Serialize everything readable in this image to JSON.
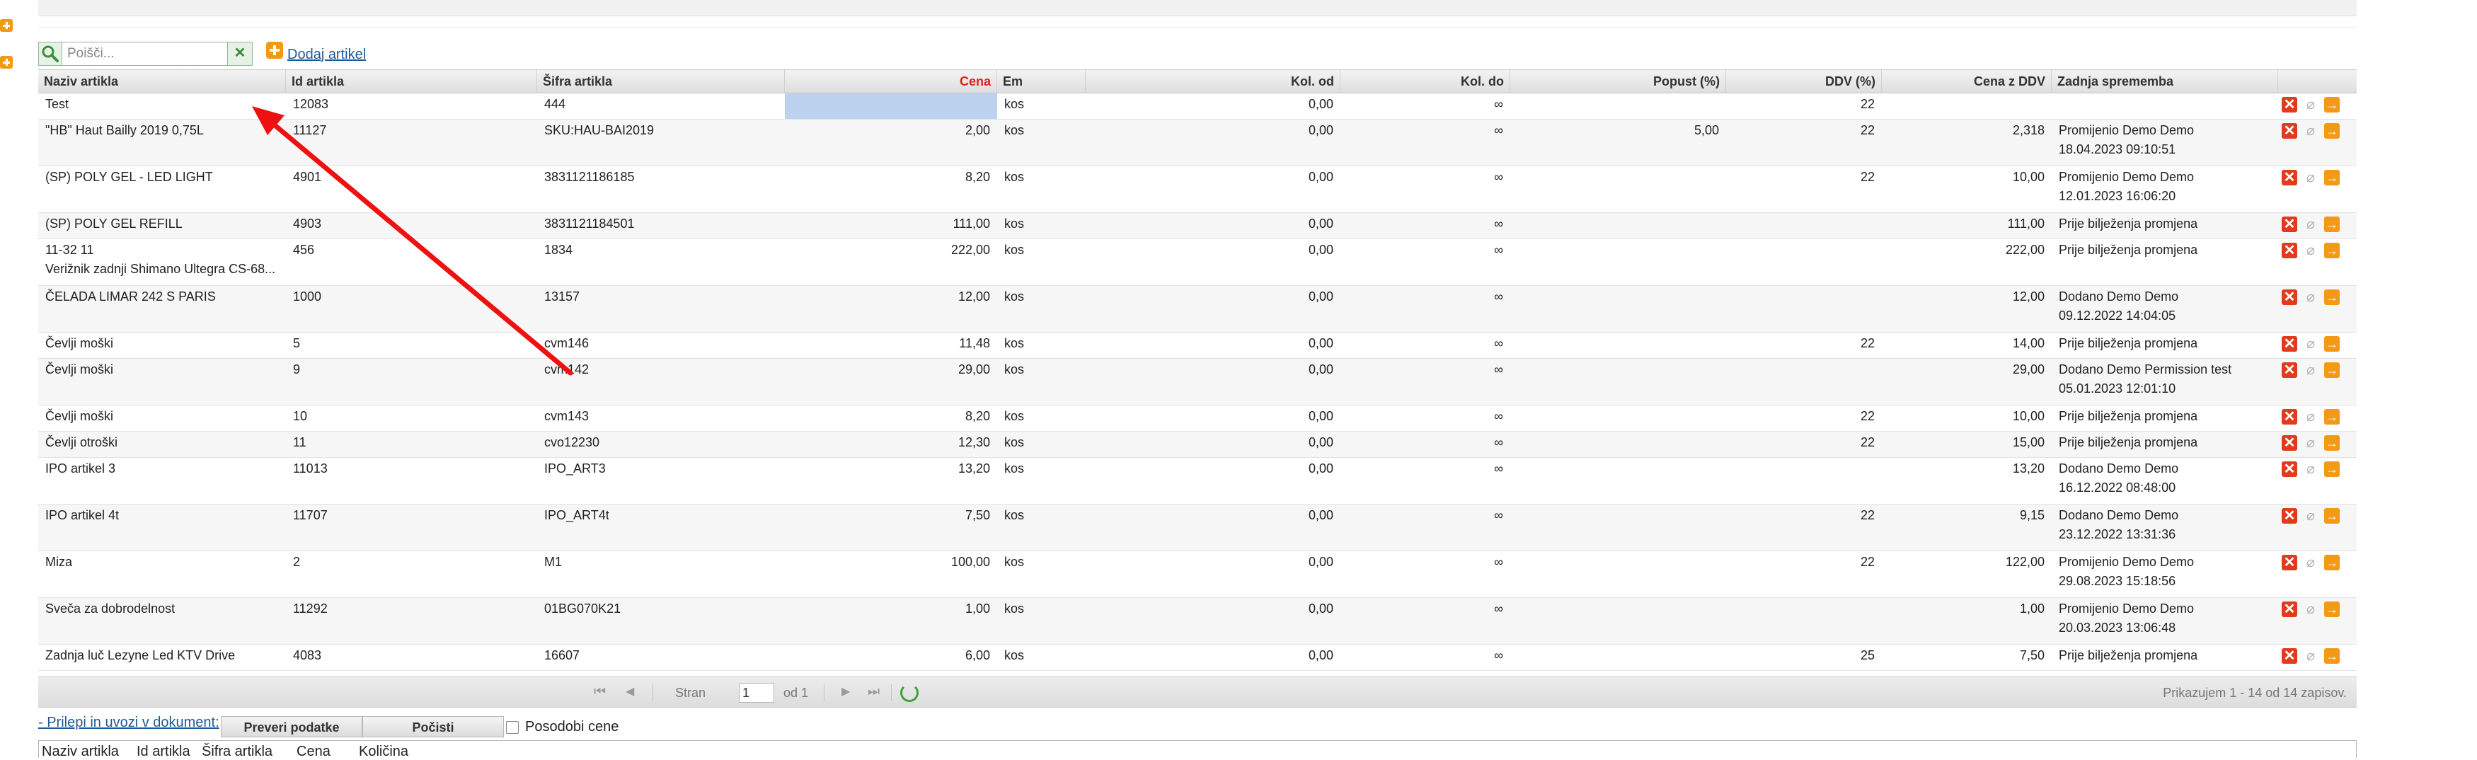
{
  "toolbar": {
    "search_placeholder": "Poišči...",
    "clear_glyph": "✕",
    "add_label": "Dodaj artikel"
  },
  "grid": {
    "columns": [
      {
        "key": "name",
        "label": "Naziv artikla"
      },
      {
        "key": "id",
        "label": "Id artikla"
      },
      {
        "key": "code",
        "label": "Šifra artikla"
      },
      {
        "key": "price",
        "label": "Cena"
      },
      {
        "key": "unit",
        "label": "Em"
      },
      {
        "key": "qty_from",
        "label": "Kol. od"
      },
      {
        "key": "qty_to",
        "label": "Kol. do"
      },
      {
        "key": "discount",
        "label": "Popust (%)"
      },
      {
        "key": "vat",
        "label": "DDV (%)"
      },
      {
        "key": "price_vat",
        "label": "Cena z DDV"
      },
      {
        "key": "last_change",
        "label": "Zadnja sprememba"
      }
    ],
    "rows": [
      {
        "name": "Test",
        "id": "12083",
        "code": "444",
        "price": "",
        "unit": "kos",
        "qty_from": "0,00",
        "qty_to": "∞",
        "discount": "",
        "vat": "22",
        "price_vat": "",
        "last_change": ""
      },
      {
        "name": "\"HB\" Haut Bailly 2019 0,75L",
        "id": "11127",
        "code": "SKU:HAU-BAI2019",
        "price": "2,00",
        "unit": "kos",
        "qty_from": "0,00",
        "qty_to": "∞",
        "discount": "5,00",
        "vat": "22",
        "price_vat": "2,318",
        "last_change": "Promijenio Demo Demo\n18.04.2023 09:10:51"
      },
      {
        "name": "(SP) POLY GEL - LED LIGHT",
        "id": "4901",
        "code": "3831121186185",
        "price": "8,20",
        "unit": "kos",
        "qty_from": "0,00",
        "qty_to": "∞",
        "discount": "",
        "vat": "22",
        "price_vat": "10,00",
        "last_change": "Promijenio Demo Demo\n12.01.2023 16:06:20"
      },
      {
        "name": "(SP) POLY GEL REFILL",
        "id": "4903",
        "code": "3831121184501",
        "price": "111,00",
        "unit": "kos",
        "qty_from": "0,00",
        "qty_to": "∞",
        "discount": "",
        "vat": "",
        "price_vat": "111,00",
        "last_change": "Prije bilježenja promjena"
      },
      {
        "name": "11-32 11\nVerižnik zadnji Shimano Ultegra CS-68...",
        "id": "456",
        "code": "1834",
        "price": "222,00",
        "unit": "kos",
        "qty_from": "0,00",
        "qty_to": "∞",
        "discount": "",
        "vat": "",
        "price_vat": "222,00",
        "last_change": "Prije bilježenja promjena"
      },
      {
        "name": "ČELADA LIMAR 242 S PARIS",
        "id": "1000",
        "code": "13157",
        "price": "12,00",
        "unit": "kos",
        "qty_from": "0,00",
        "qty_to": "∞",
        "discount": "",
        "vat": "",
        "price_vat": "12,00",
        "last_change": "Dodano Demo Demo\n09.12.2022 14:04:05"
      },
      {
        "name": "Čevlji moški",
        "id": "5",
        "code": "cvm146",
        "price": "11,48",
        "unit": "kos",
        "qty_from": "0,00",
        "qty_to": "∞",
        "discount": "",
        "vat": "22",
        "price_vat": "14,00",
        "last_change": "Prije bilježenja promjena"
      },
      {
        "name": "Čevlji moški",
        "id": "9",
        "code": "cvm142",
        "price": "29,00",
        "unit": "kos",
        "qty_from": "0,00",
        "qty_to": "∞",
        "discount": "",
        "vat": "",
        "price_vat": "29,00",
        "last_change": "Dodano Demo Permission test\n05.01.2023 12:01:10"
      },
      {
        "name": "Čevlji moški",
        "id": "10",
        "code": "cvm143",
        "price": "8,20",
        "unit": "kos",
        "qty_from": "0,00",
        "qty_to": "∞",
        "discount": "",
        "vat": "22",
        "price_vat": "10,00",
        "last_change": "Prije bilježenja promjena"
      },
      {
        "name": "Čevlji otroški",
        "id": "11",
        "code": "cvo12230",
        "price": "12,30",
        "unit": "kos",
        "qty_from": "0,00",
        "qty_to": "∞",
        "discount": "",
        "vat": "22",
        "price_vat": "15,00",
        "last_change": "Prije bilježenja promjena"
      },
      {
        "name": "IPO artikel 3",
        "id": "11013",
        "code": "IPO_ART3",
        "price": "13,20",
        "unit": "kos",
        "qty_from": "0,00",
        "qty_to": "∞",
        "discount": "",
        "vat": "",
        "price_vat": "13,20",
        "last_change": "Dodano Demo Demo\n16.12.2022 08:48:00"
      },
      {
        "name": "IPO artikel 4t",
        "id": "11707",
        "code": "IPO_ART4t",
        "price": "7,50",
        "unit": "kos",
        "qty_from": "0,00",
        "qty_to": "∞",
        "discount": "",
        "vat": "22",
        "price_vat": "9,15",
        "last_change": "Dodano Demo Demo\n23.12.2022 13:31:36"
      },
      {
        "name": "Miza",
        "id": "2",
        "code": "M1",
        "price": "100,00",
        "unit": "kos",
        "qty_from": "0,00",
        "qty_to": "∞",
        "discount": "",
        "vat": "22",
        "price_vat": "122,00",
        "last_change": "Promijenio Demo Demo\n29.08.2023 15:18:56"
      },
      {
        "name": "Sveča za dobrodelnost",
        "id": "11292",
        "code": "01BG070K21",
        "price": "1,00",
        "unit": "kos",
        "qty_from": "0,00",
        "qty_to": "∞",
        "discount": "",
        "vat": "",
        "price_vat": "1,00",
        "last_change": "Promijenio Demo Demo\n20.03.2023 13:06:48"
      },
      {
        "name": "Zadnja luč Lezyne Led KTV Drive",
        "id": "4083",
        "code": "16607",
        "price": "6,00",
        "unit": "kos",
        "qty_from": "0,00",
        "qty_to": "∞",
        "discount": "",
        "vat": "25",
        "price_vat": "7,50",
        "last_change": "Prije bilježenja promjena"
      }
    ]
  },
  "pager": {
    "first_glyph": "⏮",
    "prev_glyph": "◀",
    "next_glyph": "▶",
    "last_glyph": "⏭",
    "page_label": "Stran",
    "page_value": "1",
    "of_label": "od 1",
    "info": "Prikazujem 1 - 14 od 14 zapisov."
  },
  "import": {
    "link_label": "- Prilepi in uvozi v dokument:",
    "check_button": "Preveri podatke",
    "clear_button": "Počisti",
    "update_prices_label": "Posodobi cene",
    "update_prices_checked": false,
    "columns": [
      "Naziv artikla",
      "Id artikla",
      "Šifra artikla",
      "Cena",
      "Količina"
    ]
  },
  "row_actions": {
    "delete_glyph": "✕",
    "attach_glyph": "⌀",
    "open_glyph": "→"
  },
  "colors": {
    "accent_orange": "#f29a16",
    "delete_red": "#e03b1c",
    "link_blue": "#1f5a98",
    "annotation_arrow": "#ee1111",
    "price_header": "#e02020"
  }
}
